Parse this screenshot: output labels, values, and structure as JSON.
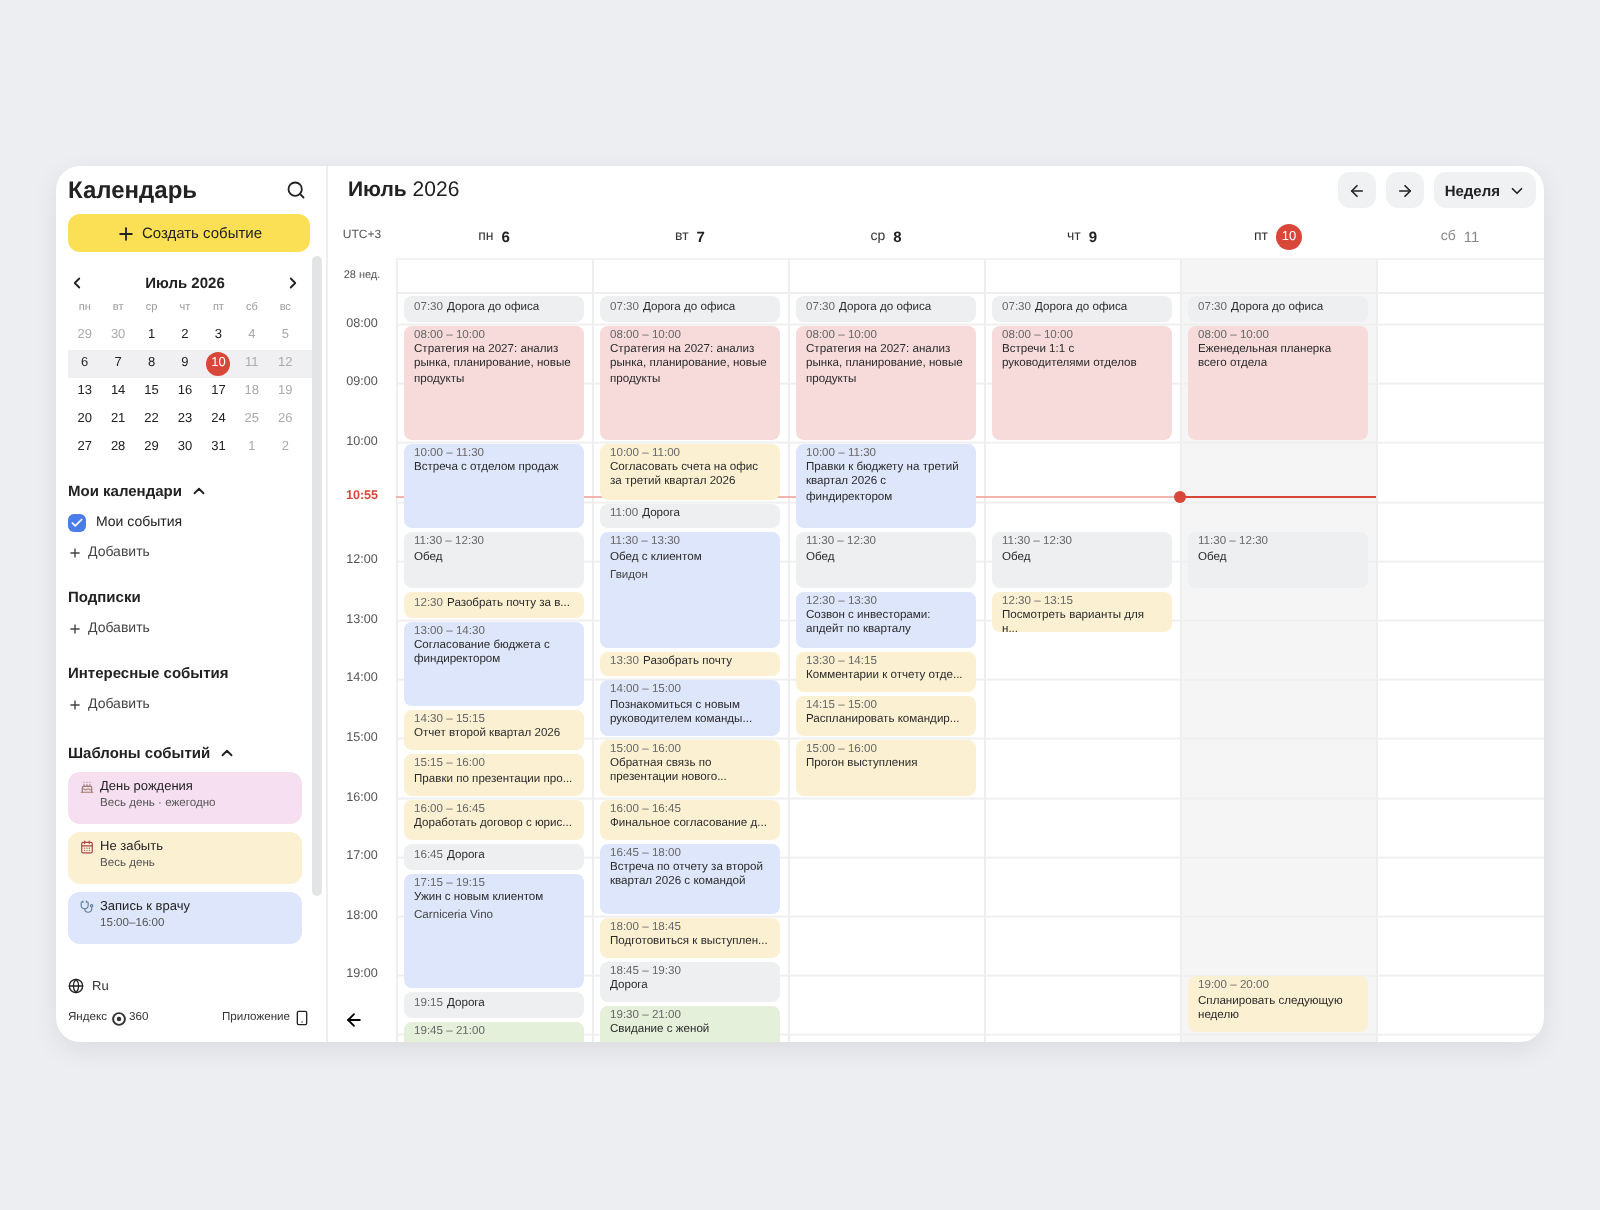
{
  "sidebar": {
    "title": "Календарь",
    "create_button": "Создать событие",
    "mini_calendar": {
      "month": "Июль 2026",
      "weekdays": [
        "пн",
        "вт",
        "ср",
        "чт",
        "пт",
        "сб",
        "вс"
      ],
      "weeks": [
        {
          "current": false,
          "days": [
            {
              "day": "29",
              "muted": true,
              "selected": false
            },
            {
              "day": "30",
              "muted": true,
              "selected": false
            },
            {
              "day": "1",
              "muted": false,
              "selected": false
            },
            {
              "day": "2",
              "muted": false,
              "selected": false
            },
            {
              "day": "3",
              "muted": false,
              "selected": false
            },
            {
              "day": "4",
              "muted": true,
              "selected": false
            },
            {
              "day": "5",
              "muted": true,
              "selected": false
            }
          ]
        },
        {
          "current": true,
          "days": [
            {
              "day": "6",
              "muted": false,
              "selected": false
            },
            {
              "day": "7",
              "muted": false,
              "selected": false
            },
            {
              "day": "8",
              "muted": false,
              "selected": false
            },
            {
              "day": "9",
              "muted": false,
              "selected": false
            },
            {
              "day": "10",
              "muted": false,
              "selected": true
            },
            {
              "day": "11",
              "muted": true,
              "selected": false
            },
            {
              "day": "12",
              "muted": true,
              "selected": false
            }
          ]
        },
        {
          "current": false,
          "days": [
            {
              "day": "13",
              "muted": false,
              "selected": false
            },
            {
              "day": "14",
              "muted": false,
              "selected": false
            },
            {
              "day": "15",
              "muted": false,
              "selected": false
            },
            {
              "day": "16",
              "muted": false,
              "selected": false
            },
            {
              "day": "17",
              "muted": false,
              "selected": false
            },
            {
              "day": "18",
              "muted": true,
              "selected": false
            },
            {
              "day": "19",
              "muted": true,
              "selected": false
            }
          ]
        },
        {
          "current": false,
          "days": [
            {
              "day": "20",
              "muted": false,
              "selected": false
            },
            {
              "day": "21",
              "muted": false,
              "selected": false
            },
            {
              "day": "22",
              "muted": false,
              "selected": false
            },
            {
              "day": "23",
              "muted": false,
              "selected": false
            },
            {
              "day": "24",
              "muted": false,
              "selected": false
            },
            {
              "day": "25",
              "muted": true,
              "selected": false
            },
            {
              "day": "26",
              "muted": true,
              "selected": false
            }
          ]
        },
        {
          "current": false,
          "days": [
            {
              "day": "27",
              "muted": false,
              "selected": false
            },
            {
              "day": "28",
              "muted": false,
              "selected": false
            },
            {
              "day": "29",
              "muted": false,
              "selected": false
            },
            {
              "day": "30",
              "muted": false,
              "selected": false
            },
            {
              "day": "31",
              "muted": false,
              "selected": false
            },
            {
              "day": "1",
              "muted": true,
              "selected": false
            },
            {
              "day": "2",
              "muted": true,
              "selected": false
            }
          ]
        }
      ]
    },
    "sections": [
      {
        "title": "Мои календари",
        "expanded": true,
        "calendars": [
          {
            "name": "Мои события",
            "checked": true
          }
        ],
        "add": "Добавить"
      },
      {
        "title": "Подписки",
        "add": "Добавить"
      },
      {
        "title": "Интересные события",
        "add": "Добавить"
      }
    ],
    "templates": {
      "title": "Шаблоны событий",
      "expanded": true,
      "items": [
        {
          "kind": "birthday",
          "title": "День рождения",
          "subtitle": "Весь день · ежегодно",
          "color": "#f5dff0"
        },
        {
          "kind": "reminder",
          "title": "Не забыть",
          "subtitle": "Весь день",
          "color": "#fcf0d2"
        },
        {
          "kind": "appointment",
          "title": "Запись к врачу",
          "subtitle": "15:00–16:00",
          "color": "#dde6fa"
        }
      ]
    },
    "language": "Ru",
    "brand": [
      "Яндекс",
      "360"
    ],
    "app_link": "Приложение"
  },
  "header": {
    "title": "**Июль** 2026",
    "view": "Неделя"
  },
  "timezone": "UTC+3",
  "week_label": "28 нед.",
  "hours": [
    "08:00",
    "09:00",
    "10:00",
    "12:00",
    "13:00",
    "14:00",
    "15:00",
    "16:00",
    "17:00",
    "18:00",
    "19:00"
  ],
  "now": "10:55",
  "days": [
    {
      "weekday": "пн",
      "date": "6",
      "today": false,
      "weekend": false,
      "events": [
        {
          "kind": "inline",
          "time": "07:30",
          "title": "Дорога до офиса",
          "color": "#eeeff1"
        },
        {
          "kind": "block",
          "time": "08:00 – 10:00",
          "title": "Стратегия на 2027: анализ рынка, планирование, новые продукты",
          "color": "#f6dbda"
        },
        {
          "kind": "block",
          "time": "10:00 – 11:30",
          "title": "Встреча с отделом продаж",
          "color": "#dde6fa"
        },
        {
          "kind": "block",
          "time": "11:30 – 12:30",
          "title": "Обед",
          "color": "#eeeff1"
        },
        {
          "kind": "inline",
          "time": "12:30",
          "title": "Разобрать почту за в...",
          "color": "#fcf0d2"
        },
        {
          "kind": "block",
          "time": "13:00 – 14:30",
          "title": "Согласование бюджета с финдиректором",
          "color": "#dde6fa"
        },
        {
          "kind": "block",
          "time": "14:30 – 15:15",
          "title": "Отчет второй квартал 2026",
          "color": "#fcf0d2"
        },
        {
          "kind": "block",
          "time": "15:15 – 16:00",
          "title": "Правки по презентации про...",
          "color": "#fcf0d2"
        },
        {
          "kind": "block",
          "time": "16:00 – 16:45",
          "title": "Доработать договор с юрис...",
          "color": "#fcf0d2"
        },
        {
          "kind": "inline",
          "time": "16:45",
          "title": "Дорога",
          "color": "#eeeff1"
        },
        {
          "kind": "block",
          "time": "17:15 – 19:15",
          "title": "Ужин с новым клиентом",
          "location": "Carniceria Vino",
          "color": "#dde6fa"
        },
        {
          "kind": "inline",
          "time": "19:15",
          "title": "Дорога",
          "color": "#eeeff1"
        },
        {
          "kind": "block",
          "time": "19:45 – 21:00",
          "color": "#e4f0da"
        }
      ]
    },
    {
      "weekday": "вт",
      "date": "7",
      "today": false,
      "weekend": false,
      "events": [
        {
          "kind": "inline",
          "time": "07:30",
          "title": "Дорога до офиса",
          "color": "#eeeff1"
        },
        {
          "kind": "block",
          "time": "08:00 – 10:00",
          "title": "Стратегия на 2027: анализ рынка, планирование, новые продукты",
          "color": "#f6dbda"
        },
        {
          "kind": "block",
          "time": "10:00 – 11:00",
          "title": "Согласовать счета на офис за третий квартал 2026",
          "color": "#fcf0d2"
        },
        {
          "kind": "inline",
          "time": "11:00",
          "title": "Дорога",
          "color": "#eeeff1"
        },
        {
          "kind": "block",
          "time": "11:30 – 13:30",
          "title": "Обед с клиентом",
          "location": "Гвидон",
          "color": "#dde6fa"
        },
        {
          "kind": "inline",
          "time": "13:30",
          "title": "Разобрать почту",
          "color": "#fcf0d2"
        },
        {
          "kind": "block",
          "time": "14:00 – 15:00",
          "title": "Познакомиться с новым руководителем команды...",
          "color": "#dde6fa"
        },
        {
          "kind": "block",
          "time": "15:00 – 16:00",
          "title": "Обратная связь по презентации нового...",
          "color": "#fcf0d2"
        },
        {
          "kind": "block",
          "time": "16:00 – 16:45",
          "title": "Финальное согласование д...",
          "color": "#fcf0d2"
        },
        {
          "kind": "block",
          "time": "16:45 – 18:00",
          "title": "Встреча по отчету за второй квартал 2026 с командой",
          "color": "#dde6fa"
        },
        {
          "kind": "block",
          "time": "18:00 – 18:45",
          "title": "Подготовиться к выступлен...",
          "color": "#fcf0d2"
        },
        {
          "kind": "block",
          "time": "18:45 – 19:30",
          "title": "Дорога",
          "color": "#eeeff1"
        },
        {
          "kind": "block",
          "time": "19:30 – 21:00",
          "title": "Свидание с женой",
          "color": "#e4f0da"
        }
      ]
    },
    {
      "weekday": "ср",
      "date": "8",
      "today": false,
      "weekend": false,
      "events": [
        {
          "kind": "inline",
          "time": "07:30",
          "title": "Дорога до офиса",
          "color": "#eeeff1"
        },
        {
          "kind": "block",
          "time": "08:00 – 10:00",
          "title": "Стратегия на 2027: анализ рынка, планирование, новые продукты",
          "color": "#f6dbda"
        },
        {
          "kind": "block",
          "time": "10:00 – 11:30",
          "title": "Правки к бюджету на третий квартал 2026 с финдиректором",
          "color": "#dde6fa"
        },
        {
          "kind": "block",
          "time": "11:30 – 12:30",
          "title": "Обед",
          "color": "#eeeff1"
        },
        {
          "kind": "block",
          "time": "12:30 – 13:30",
          "title": "Созвон с инвесторами: апдейт по кварталу",
          "color": "#dde6fa"
        },
        {
          "kind": "block",
          "time": "13:30 – 14:15",
          "title": "Комментарии к отчету отде...",
          "color": "#fcf0d2"
        },
        {
          "kind": "block",
          "time": "14:15 – 15:00",
          "title": "Распланировать командир...",
          "color": "#fcf0d2"
        },
        {
          "kind": "block",
          "time": "15:00 – 16:00",
          "title": "Прогон выступления",
          "color": "#fcf0d2"
        }
      ]
    },
    {
      "weekday": "чт",
      "date": "9",
      "today": false,
      "weekend": false,
      "events": [
        {
          "kind": "inline",
          "time": "07:30",
          "title": "Дорога до офиса",
          "color": "#eeeff1"
        },
        {
          "kind": "block",
          "time": "08:00 – 10:00",
          "title": "Встречи 1:1 с руководителями отделов",
          "color": "#f6dbda"
        },
        {
          "kind": "block",
          "time": "11:30 – 12:30",
          "title": "Обед",
          "color": "#eeeff1"
        },
        {
          "kind": "block",
          "time": "12:30 – 13:15",
          "title": "Посмотреть варианты для н...",
          "color": "#fcf0d2"
        }
      ]
    },
    {
      "weekday": "пт",
      "date": "10",
      "today": true,
      "weekend": false,
      "events": [
        {
          "kind": "inline",
          "time": "07:30",
          "title": "Дорога до офиса",
          "color": "#eeeff1"
        },
        {
          "kind": "block",
          "time": "08:00 – 10:00",
          "title": "Еженедельная планерка всего отдела",
          "color": "#f6dbda"
        },
        {
          "kind": "block",
          "time": "11:30 – 12:30",
          "title": "Обед",
          "color": "#eeeff1"
        },
        {
          "kind": "block",
          "time": "19:00 – 20:00",
          "title": "Спланировать следующую неделю",
          "color": "#fcf0d2"
        }
      ]
    },
    {
      "weekday": "сб",
      "date": "11",
      "today": false,
      "weekend": true
    }
  ]
}
